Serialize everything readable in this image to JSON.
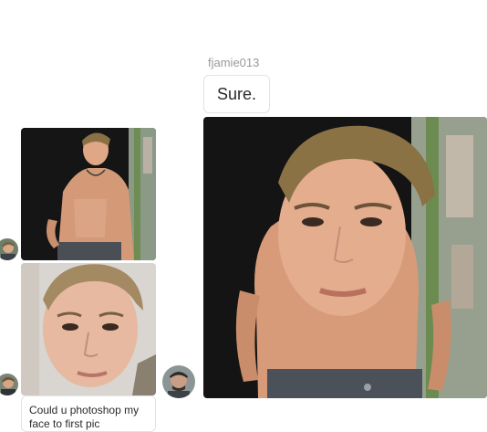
{
  "thread": {
    "sender_username": "fjamie013",
    "reply_text": "Sure.",
    "request_text": "Could u photoshop my face to first pic"
  },
  "images": {
    "photo_1": "shirtless-photo",
    "photo_2": "face-selfie-photo",
    "photo_3": "edited-photo"
  },
  "colors": {
    "background": "#ffffff",
    "bubble_border": "#e3e3e3",
    "username_text": "#9a9a9a"
  }
}
